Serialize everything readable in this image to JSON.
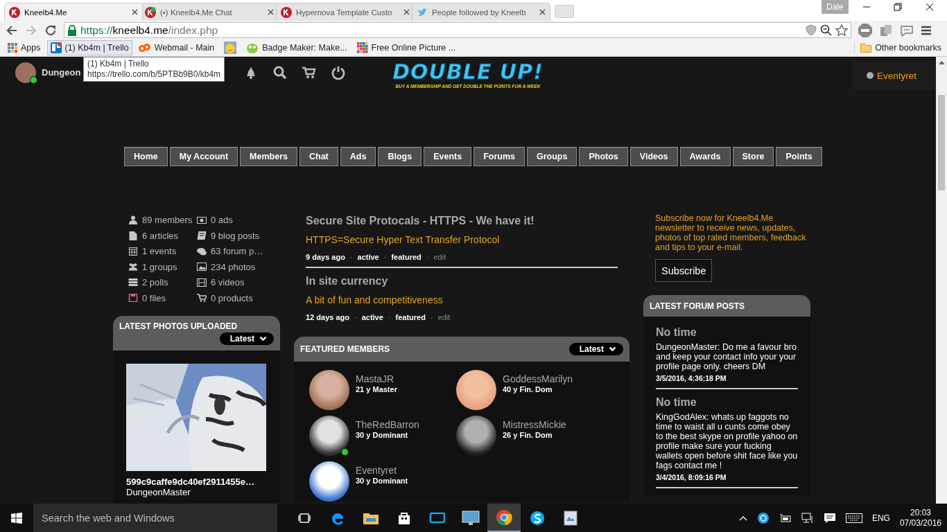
{
  "browser": {
    "tabs": [
      {
        "title": "Kneelb4.Me",
        "selected": true
      },
      {
        "title": "(•) Kneelb4.Me Chat",
        "selected": false
      },
      {
        "title": "Hypernova Template Custo",
        "selected": false
      },
      {
        "title": "People followed by Kneelb",
        "selected": false
      }
    ],
    "profile": "Dale",
    "url": {
      "scheme": "https://",
      "host": "kneelb4.me",
      "path": "/index.php"
    },
    "bookmarks": [
      {
        "label": "Apps",
        "hovered": false
      },
      {
        "label": "(1) Kb4m | Trello",
        "hovered": true
      },
      {
        "label": "Webmail - Main",
        "hovered": false
      },
      {
        "hovered": false
      },
      {
        "label": "Badge Maker: Make...",
        "hovered": false
      },
      {
        "label": "Free Online Picture ...",
        "hovered": false
      }
    ],
    "other_bookmarks": "Other bookmarks",
    "tooltip": {
      "title": "(1) Kb4m | Trello",
      "url": "https://trello.com/b/5PTBb9B0/kb4m"
    }
  },
  "site": {
    "user": {
      "name": "Dungeon",
      "online": true
    },
    "logo": {
      "title": "DOUBLE UP!",
      "tagline": "BUY A MEMBERSHIP AND GET DOUBLE THE POINTS FOR A WEEK"
    },
    "top_right_user": "Eventyret",
    "nav": [
      "Home",
      "My Account",
      "Members",
      "Chat",
      "Ads",
      "Blogs",
      "Events",
      "Forums",
      "Groups",
      "Photos",
      "Videos",
      "Awards",
      "Store",
      "Points"
    ],
    "stats": [
      "89 members",
      "0 ads",
      "6 articles",
      "9 blog posts",
      "1 events",
      "63 forum p…",
      "1 groups",
      "234 photos",
      "2 polls",
      "6 videos",
      "0 files",
      "0 products"
    ],
    "photos_panel": {
      "title": "LATEST PHOTOS UPLOADED",
      "sort": "Latest",
      "photo": {
        "kind": "picture",
        "caption": "599c9caffe9dc40ef2911455e…",
        "author": "DungeonMaster"
      }
    },
    "posts": [
      {
        "title": "Secure Site Protocals - HTTPS - We have it!",
        "subtitle": "HTTPS=Secure Hyper Text Transfer Protocol",
        "age": "9 days ago",
        "separator": "·",
        "status": "active",
        "flag": "featured",
        "action": "edit"
      },
      {
        "title": "In site currency",
        "subtitle": "A bit of fun and competitiveness",
        "age": "12 days ago",
        "separator": "·",
        "status": "active",
        "flag": "featured",
        "action": "edit"
      }
    ],
    "featured": {
      "title": "FEATURED MEMBERS",
      "sort": "Latest",
      "members": [
        {
          "name": "MastaJR",
          "info": "21 y Master",
          "online": false
        },
        {
          "name": "GoddessMarilyn",
          "info": "40 y Fin. Dom",
          "online": false
        },
        {
          "name": "TheRedBarron",
          "info": "30 y Dominant",
          "online": true
        },
        {
          "name": "MistressMickie",
          "info": "26 y Fin. Dom",
          "online": false
        },
        {
          "name": "Eventyret",
          "info": "30 y Dominant",
          "online": false
        }
      ]
    },
    "subscribe": {
      "text": "Subscribe now for Kneelb4.Me newsletter to receive news, updates, photos of top rated members, feedback and tips to your e-mail.",
      "button": "Subscribe"
    },
    "forum": {
      "title": "LATEST FORUM POSTS",
      "posts": [
        {
          "title": "No time",
          "body": "DungeonMaster: Do me a favour bro and keep your contact info your your profile page only. cheers   DM",
          "date": "3/5/2016, 4:36:18 PM"
        },
        {
          "title": "No time",
          "body": "KingGodAlex: whats up faggots no time to waist all u cunts come obey to the best skype on profile yahoo on profile make sure your fucking wallets open before shit face like you fags contact me !",
          "date": "3/4/2016, 8:09:16 PM"
        }
      ]
    }
  },
  "taskbar": {
    "search_placeholder": "Search the web and Windows",
    "language": "ENG",
    "time": "20:03",
    "date": "07/03/2016"
  }
}
